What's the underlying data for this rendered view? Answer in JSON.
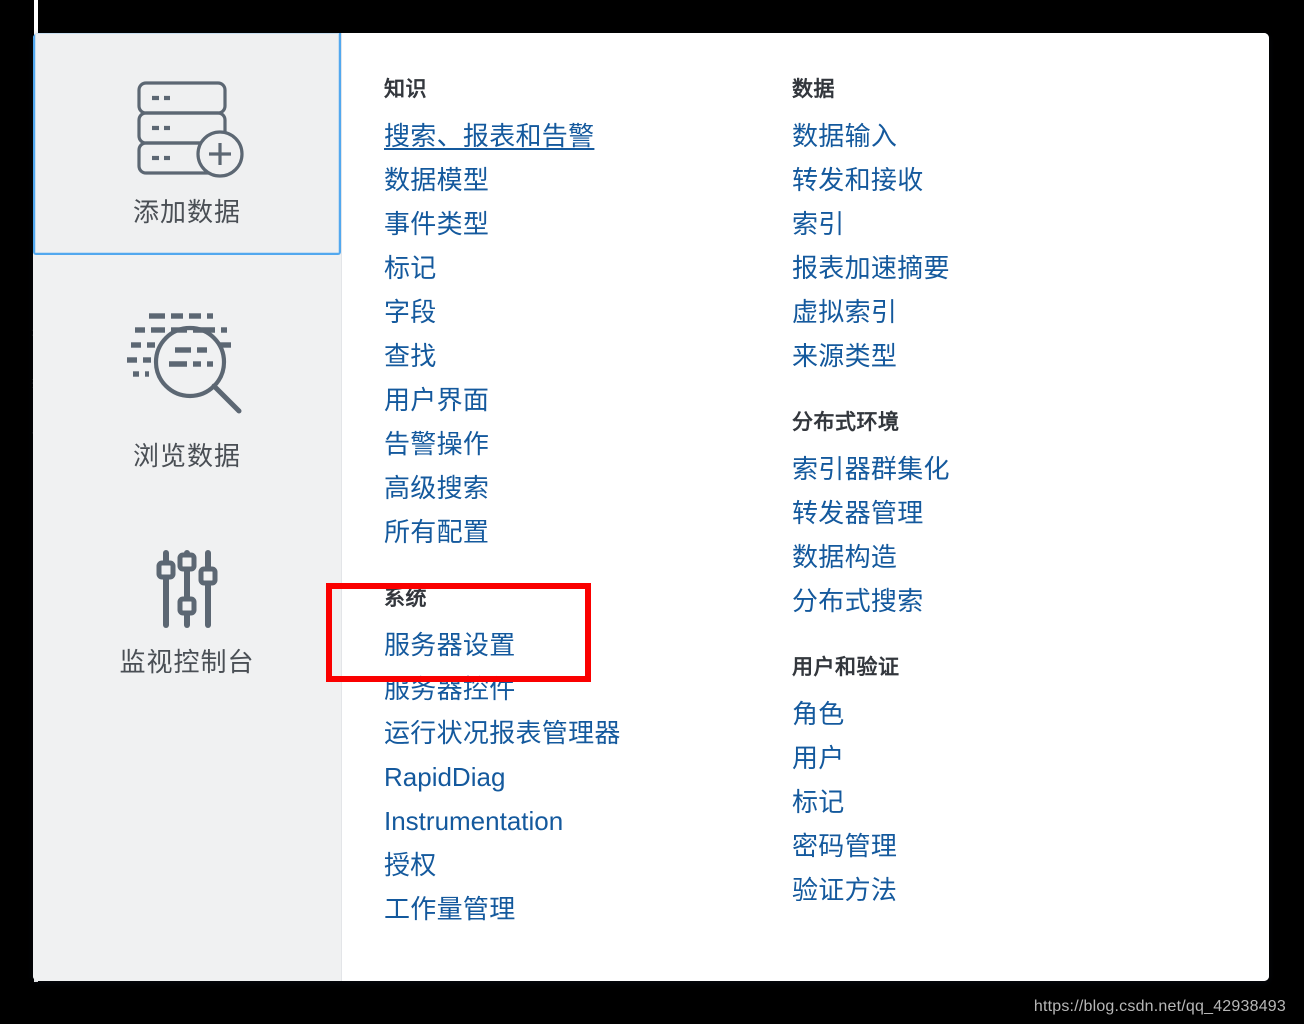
{
  "sidebar": {
    "items": [
      {
        "label": "添加数据",
        "icon": "server-add-icon",
        "selected": true
      },
      {
        "label": "浏览数据",
        "icon": "magnifier-data-icon",
        "selected": false
      },
      {
        "label": "监视控制台",
        "icon": "sliders-icon",
        "selected": false
      }
    ]
  },
  "columns": [
    {
      "groups": [
        {
          "title": "知识",
          "links": [
            {
              "label": "搜索、报表和告警",
              "hovered": true
            },
            {
              "label": "数据模型",
              "hovered": false
            },
            {
              "label": "事件类型",
              "hovered": false
            },
            {
              "label": "标记",
              "hovered": false
            },
            {
              "label": "字段",
              "hovered": false
            },
            {
              "label": "查找",
              "hovered": false
            },
            {
              "label": "用户界面",
              "hovered": false
            },
            {
              "label": "告警操作",
              "hovered": false
            },
            {
              "label": "高级搜索",
              "hovered": false
            },
            {
              "label": "所有配置",
              "hovered": false
            }
          ]
        },
        {
          "title": "系统",
          "links": [
            {
              "label": "服务器设置",
              "hovered": false,
              "highlighted": true
            },
            {
              "label": "服务器控件",
              "hovered": false
            },
            {
              "label": "运行状况报表管理器",
              "hovered": false
            },
            {
              "label": "RapidDiag",
              "hovered": false,
              "latin": true
            },
            {
              "label": "Instrumentation",
              "hovered": false,
              "latin": true
            },
            {
              "label": "授权",
              "hovered": false
            },
            {
              "label": "工作量管理",
              "hovered": false
            }
          ]
        }
      ]
    },
    {
      "groups": [
        {
          "title": "数据",
          "links": [
            {
              "label": "数据输入",
              "hovered": false
            },
            {
              "label": "转发和接收",
              "hovered": false
            },
            {
              "label": "索引",
              "hovered": false
            },
            {
              "label": "报表加速摘要",
              "hovered": false
            },
            {
              "label": "虚拟索引",
              "hovered": false
            },
            {
              "label": "来源类型",
              "hovered": false
            }
          ]
        },
        {
          "title": "分布式环境",
          "links": [
            {
              "label": "索引器群集化",
              "hovered": false
            },
            {
              "label": "转发器管理",
              "hovered": false
            },
            {
              "label": "数据构造",
              "hovered": false
            },
            {
              "label": "分布式搜索",
              "hovered": false
            }
          ]
        },
        {
          "title": "用户和验证",
          "links": [
            {
              "label": "角色",
              "hovered": false
            },
            {
              "label": "用户",
              "hovered": false
            },
            {
              "label": "标记",
              "hovered": false
            },
            {
              "label": "密码管理",
              "hovered": false
            },
            {
              "label": "验证方法",
              "hovered": false
            }
          ]
        }
      ]
    }
  ],
  "annotation": {
    "kind": "red-highlight-box",
    "target": "服务器设置",
    "color": "#fa0000"
  },
  "watermark": {
    "text": "https://blog.csdn.net/qq_42938493"
  },
  "colors": {
    "link": "#14599d",
    "group_title": "#33373d",
    "sidebar_bg": "#f0f1f2",
    "selected_border": "#52a8ef",
    "annotation_red": "#fa0000",
    "icon_stroke": "#5c6773",
    "backdrop_tick_green": "#4fae4c"
  }
}
